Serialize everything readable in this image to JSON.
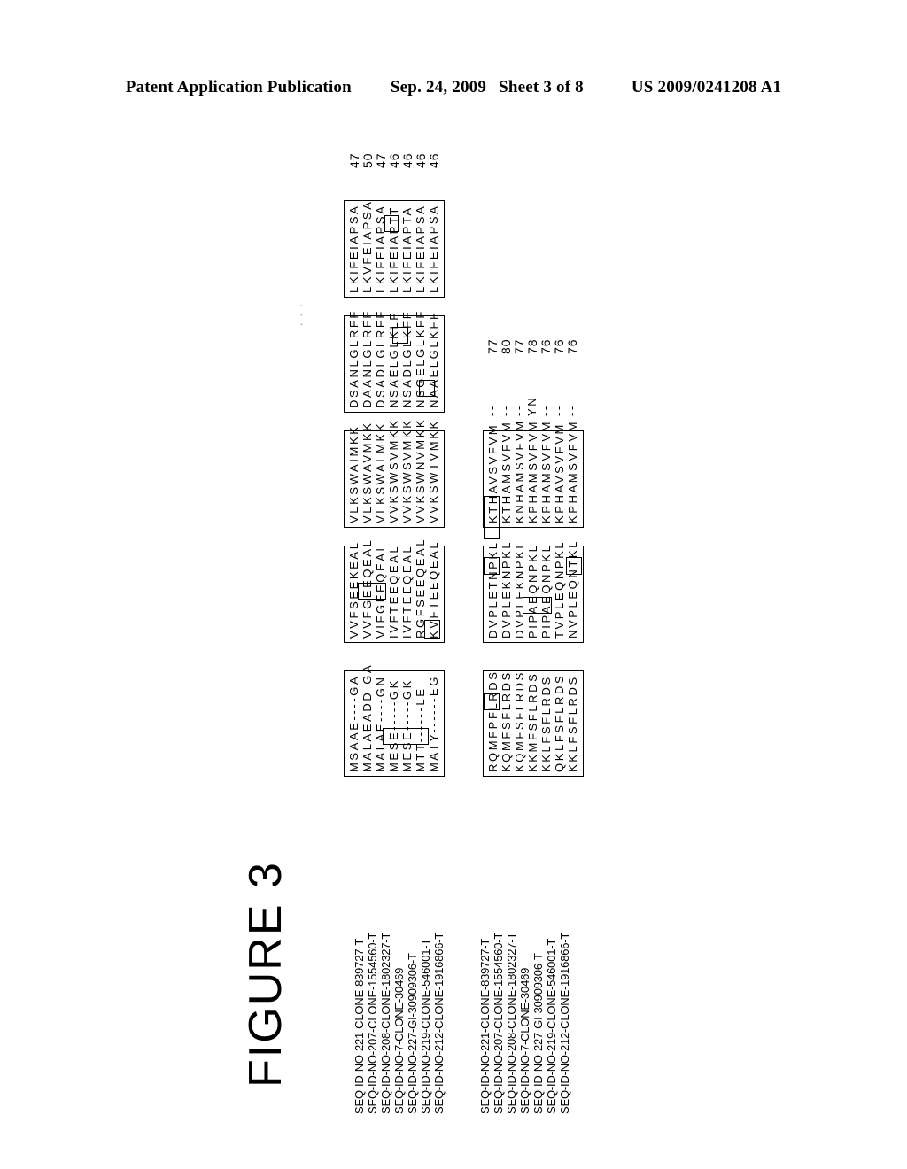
{
  "header": {
    "publication": "Patent Application Publication",
    "date": "Sep. 24, 2009",
    "sheet": "Sheet 3 of 8",
    "patent_number": "US 2009/0241208 A1"
  },
  "figure": {
    "title": "FIGURE  3"
  },
  "alignment": {
    "sequence_labels": [
      "SEQ-ID-NO-221-CLONE-839727-T",
      "SEQ-ID-NO-207-CLONE-1554560-T",
      "SEQ-ID-NO-208-CLONE-1802327-T",
      "SEQ-ID-NO-7-CLONE-30469",
      "SEQ-ID-NO-227-GI-30909306-T",
      "SEQ-ID-NO-219-CLONE-546001-T",
      "SEQ-ID-NO-212-CLONE-1916866-T"
    ],
    "block1": {
      "end_positions": [
        "47",
        "50",
        "47",
        "46",
        "46",
        "46",
        "46"
      ],
      "columns": [
        {
          "name": "col-1",
          "boxed": true,
          "rows": [
            "MSAAE----GA",
            "MALAEADD-GA",
            "MALAE----GN",
            "MESE-----GK",
            "MESE-----GK",
            "MTT------LE",
            "MATY------EG"
          ]
        },
        {
          "name": "col-2",
          "boxed": true,
          "rows": [
            "VVFSEEKEAL",
            "VVFGEEQEAL",
            "VIFGEEQEAL",
            "IVFTEEQEAL",
            "IVFTEEQEAL",
            "RGFSEEQEAL",
            "KVFTEEQEAL"
          ]
        },
        {
          "name": "col-3",
          "boxed": true,
          "rows": [
            "VLKSWAIMKK",
            "VLKSWAVMKK",
            "VLKSWALMKK",
            "VVKSWSVMKK",
            "VVKSWSVMKK",
            "VVKSWNVMKK",
            "VVKSWTVMKK"
          ]
        },
        {
          "name": "col-4",
          "boxed": true,
          "rows": [
            "DSANLGLRFF",
            "DAANLGLRFF",
            "DSADLGLRFF",
            "NSAELGLKLF",
            "NSADLGLKFF",
            "NSGELGLKFF",
            "NAAELGLKFF"
          ]
        },
        {
          "name": "col-5",
          "boxed": true,
          "rows": [
            "LKIFEIAPSA",
            "LKVFEIAPSA",
            "LKIFEIAPSA",
            "LKIFEIAPTT",
            "LKIFEIAPTA",
            "LKIFEIAPSA",
            "LKIFEIAPSA"
          ]
        }
      ]
    },
    "block2": {
      "end_positions": [
        "77",
        "80",
        "77",
        "78",
        "76",
        "76",
        "76"
      ],
      "gap_column": [
        "--",
        "--",
        "--",
        "YN",
        "--",
        "--",
        "--"
      ],
      "columns": [
        {
          "name": "col-1",
          "boxed": true,
          "rows": [
            "RQMFPFLRDS",
            "KQMFSFLRDS",
            "KQMFSFLRDS",
            "KKMFSFLRDS",
            "KKLFSFLRDS",
            "QKLFSFLRDS",
            "KKLFSFLRDS"
          ]
        },
        {
          "name": "col-2",
          "boxed": true,
          "rows": [
            "DVPLETNPKL",
            "DVPLEKNPKL",
            "DVPLEKNPKL",
            "PIPAEQNPKL",
            "PIPAEQNPKL",
            "TVPLEQNPKL",
            "NVPLEQNTKL"
          ]
        },
        {
          "name": "col-3",
          "boxed": true,
          "rows": [
            "KTHAVSVFVM",
            "KTHAMSVFVM",
            "KNHAMSVFVM",
            "KPHAMSVFVM",
            "KPHAMSVFVM",
            "KPHAVSVFVM",
            "KPHAMSVFVM"
          ]
        }
      ]
    }
  }
}
